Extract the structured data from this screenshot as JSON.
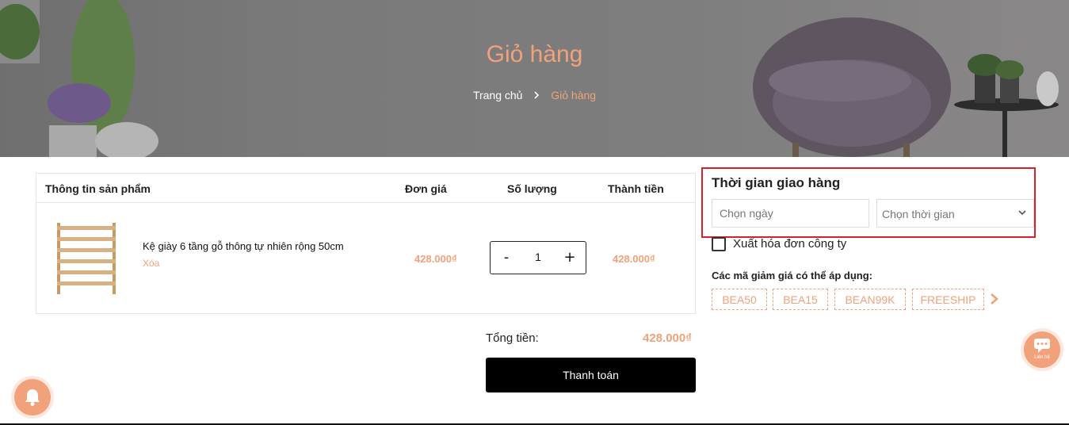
{
  "hero": {
    "title": "Giỏ hàng",
    "breadcrumb": {
      "home": "Trang chủ",
      "current": "Giỏ hàng"
    }
  },
  "cart": {
    "headers": {
      "product": "Thông tin sản phẩm",
      "price": "Đơn giá",
      "quantity": "Số lượng",
      "total": "Thành tiền"
    },
    "items": [
      {
        "name": "Kệ giày 6 tầng gỗ thông tự nhiên rộng 50cm",
        "remove_label": "Xóa",
        "unit_price": "428.000₫",
        "quantity": "1",
        "minus_label": "-",
        "plus_label": "+",
        "line_total": "428.000₫"
      }
    ],
    "total_label": "Tổng tiền:",
    "total_value": "428.000₫",
    "checkout_label": "Thanh toán"
  },
  "delivery": {
    "title": "Thời gian giao hàng",
    "date_placeholder": "Chọn ngày",
    "time_selected": "Chọn thời gian"
  },
  "invoice": {
    "label": "Xuất hóa đơn công ty",
    "checked": false
  },
  "coupons": {
    "title": "Các mã giảm giá có thể áp dụng:",
    "codes": [
      "BEA50",
      "BEA15",
      "BEAN99K",
      "FREESHIP"
    ]
  },
  "contact": {
    "label": "Liên hệ"
  },
  "colors": {
    "accent": "#f2a27a",
    "highlight_border": "#d8202a",
    "button_bg": "#000000"
  }
}
